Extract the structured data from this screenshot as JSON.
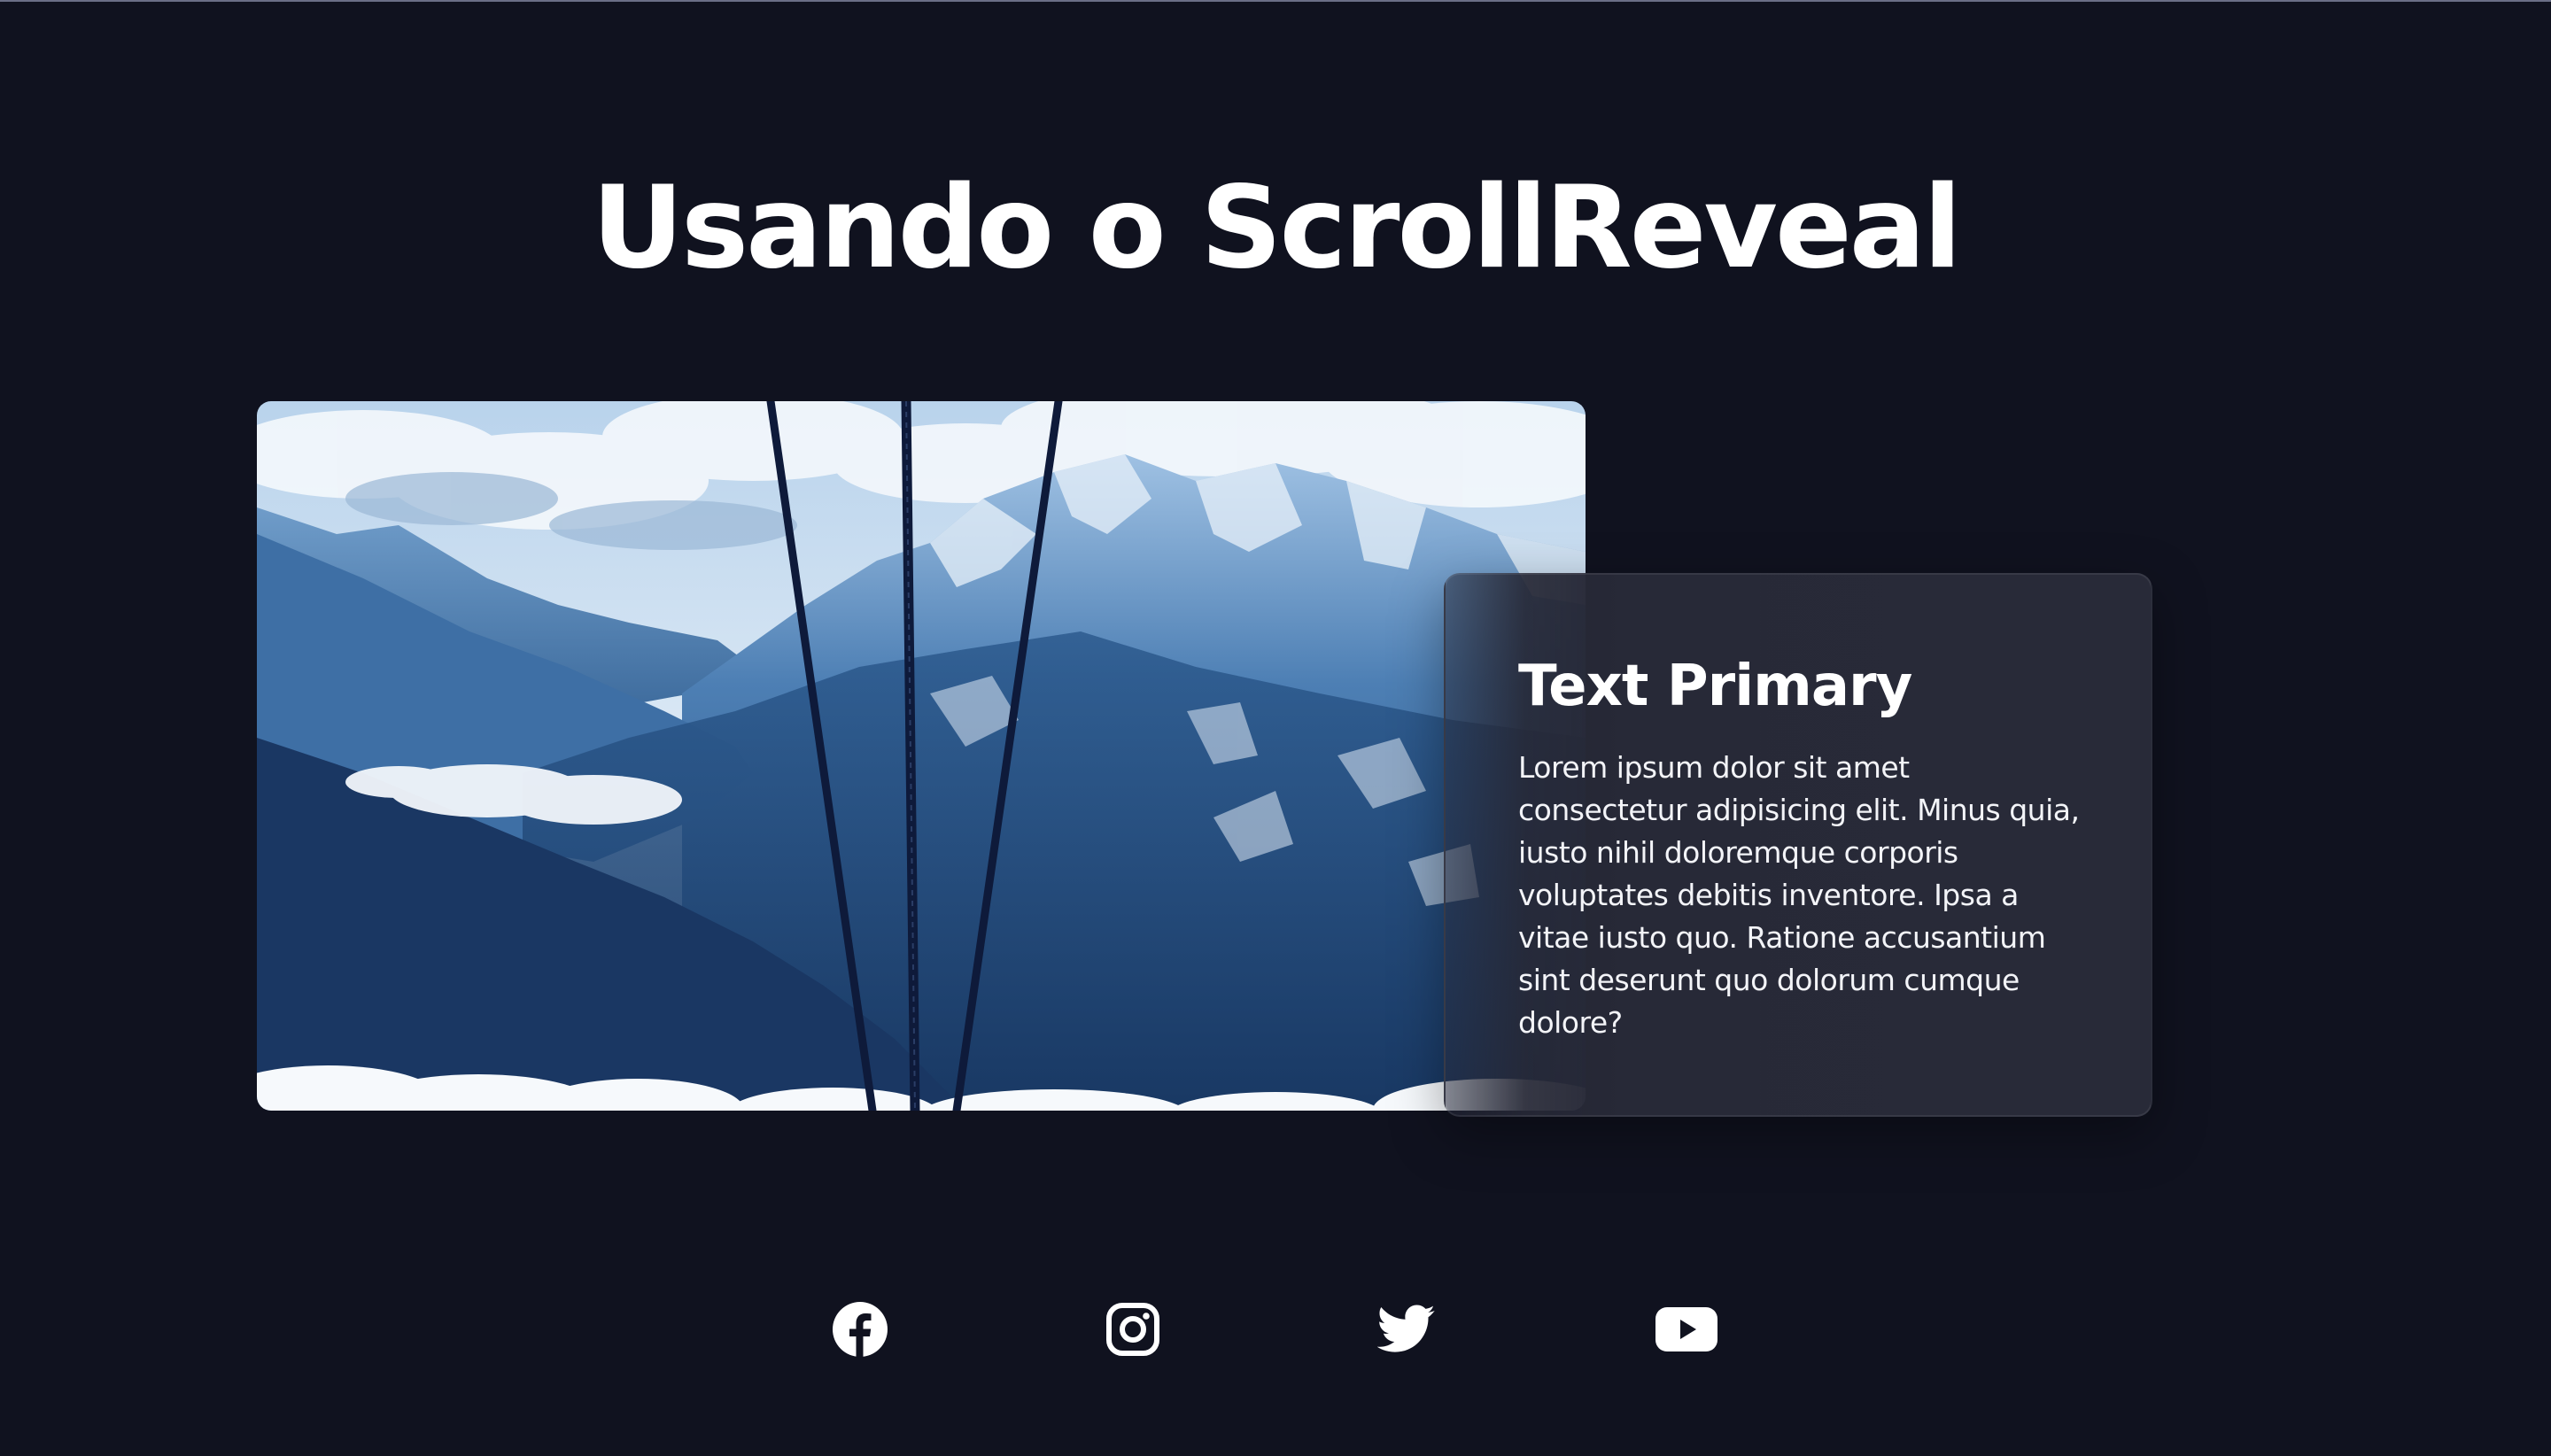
{
  "header": {
    "title": "Usando o ScrollReveal"
  },
  "hero_image": {
    "description_icon": "mountain-cable-car-photo"
  },
  "card": {
    "title": "Text Primary",
    "body": "Lorem ipsum dolor sit amet consectetur adipisicing elit. Minus quia, iusto nihil doloremque corporis voluptates debitis inventore. Ipsa a vitae iusto quo. Ratione accusantium sint deserunt quo dolorum cumque dolore?"
  },
  "social": [
    {
      "icon": "facebook-icon"
    },
    {
      "icon": "instagram-icon"
    },
    {
      "icon": "twitter-icon"
    },
    {
      "icon": "youtube-icon"
    }
  ],
  "colors": {
    "background": "#10121f",
    "card": "#282a38",
    "text": "#ffffff"
  }
}
